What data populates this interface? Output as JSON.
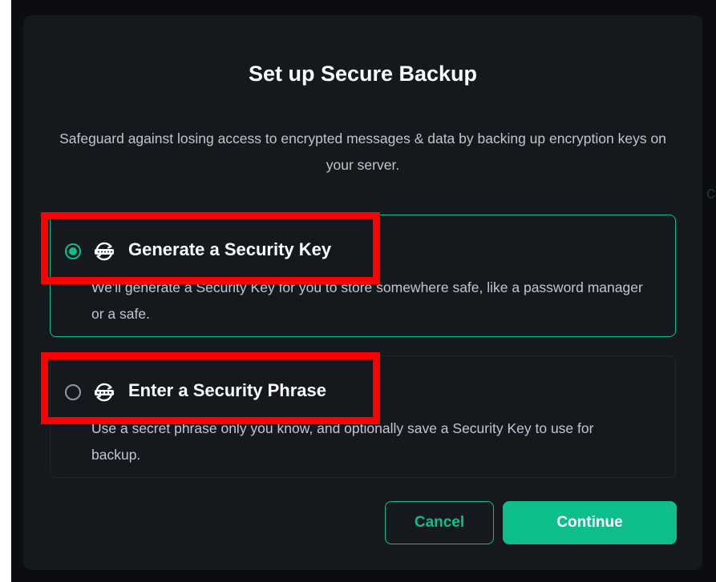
{
  "dialog": {
    "title": "Set up Secure Backup",
    "description": "Safeguard against losing access to encrypted messages & data by backing up encryption keys on your server."
  },
  "options": [
    {
      "label": "Generate a Security Key",
      "description": "We'll generate a Security Key for you to store somewhere safe, like a password manager or a safe.",
      "selected": true,
      "icon": "security-key-icon"
    },
    {
      "label": "Enter a Security Phrase",
      "description": "Use a secret phrase only you know, and optionally save a Security Key to use for backup.",
      "selected": false,
      "icon": "security-phrase-icon"
    }
  ],
  "buttons": {
    "cancel": "Cancel",
    "continue": "Continue"
  },
  "colors": {
    "accent": "#0dbd8b",
    "dialog_bg": "#15191e",
    "backdrop": "#0b0d10",
    "highlight": "#ff0000"
  }
}
